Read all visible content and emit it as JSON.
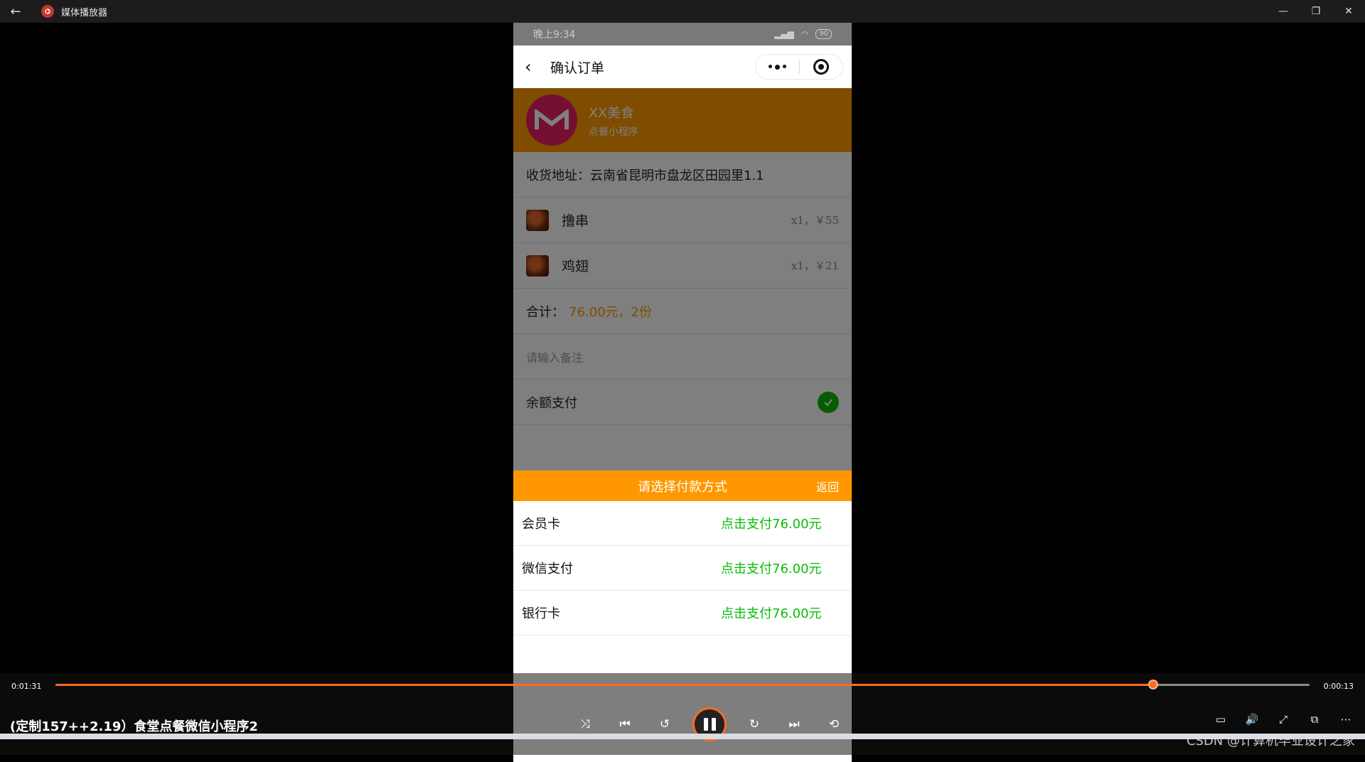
{
  "window": {
    "title": "媒体播放器"
  },
  "phone": {
    "status_time": "晚上9:34",
    "battery": "90",
    "page_title": "确认订单",
    "shop": {
      "name": "XX美食",
      "subtitle": "点餐小程序"
    },
    "address": "收货地址：云南省昆明市盘龙区田园里1.1",
    "items": [
      {
        "name": "撸串",
        "meta": "x1，￥55"
      },
      {
        "name": "鸡翅",
        "meta": "x1，￥21"
      }
    ],
    "total_label": "合计：",
    "total_value": "76.00元，2份",
    "remark_placeholder": "请输入备注",
    "pay_option": "余额支付",
    "sheet": {
      "title": "请选择付款方式",
      "back": "返回",
      "methods": [
        {
          "name": "会员卡",
          "action": "点击支付76.00元"
        },
        {
          "name": "微信支付",
          "action": "点击支付76.00元"
        },
        {
          "name": "银行卡",
          "action": "点击支付76.00元"
        }
      ]
    }
  },
  "player": {
    "elapsed": "0:01:31",
    "remaining": "0:00:13",
    "progress_fraction": 0.875,
    "video_title": "(定制157++2.19）食堂点餐微信小程序2",
    "watermark": "CSDN @计算机毕业设计之家",
    "accent_color": "#ff6a21"
  }
}
